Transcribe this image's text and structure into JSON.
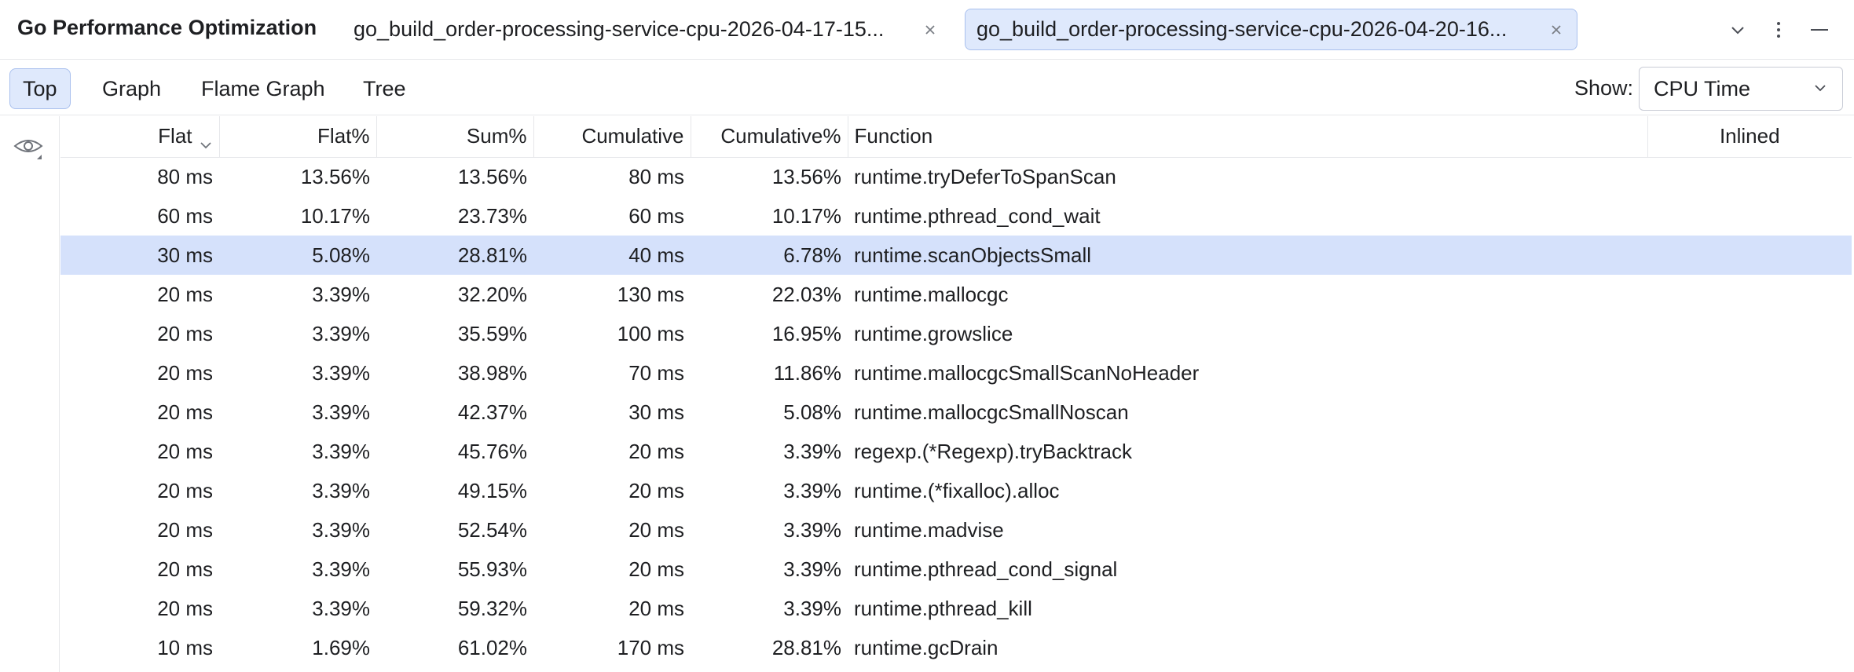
{
  "app": {
    "title": "Go Performance Optimization"
  },
  "tabs": [
    {
      "label": "go_build_order-processing-service-cpu-2026-04-17-15...",
      "active": false
    },
    {
      "label": "go_build_order-processing-service-cpu-2026-04-20-16...",
      "active": true
    }
  ],
  "views": [
    {
      "label": "Top",
      "active": true
    },
    {
      "label": "Graph",
      "active": false
    },
    {
      "label": "Flame Graph",
      "active": false
    },
    {
      "label": "Tree",
      "active": false
    }
  ],
  "show": {
    "label": "Show:",
    "value": "CPU Time"
  },
  "table": {
    "columns": [
      "Flat",
      "Flat%",
      "Sum%",
      "Cumulative",
      "Cumulative%",
      "Function",
      "Inlined"
    ],
    "sorted_by": "Flat",
    "selected_row": 2,
    "rows": [
      [
        "80 ms",
        "13.56%",
        "13.56%",
        "80 ms",
        "13.56%",
        "runtime.tryDeferToSpanScan",
        ""
      ],
      [
        "60 ms",
        "10.17%",
        "23.73%",
        "60 ms",
        "10.17%",
        "runtime.pthread_cond_wait",
        ""
      ],
      [
        "30 ms",
        "5.08%",
        "28.81%",
        "40 ms",
        "6.78%",
        "runtime.scanObjectsSmall",
        ""
      ],
      [
        "20 ms",
        "3.39%",
        "32.20%",
        "130 ms",
        "22.03%",
        "runtime.mallocgc",
        ""
      ],
      [
        "20 ms",
        "3.39%",
        "35.59%",
        "100 ms",
        "16.95%",
        "runtime.growslice",
        ""
      ],
      [
        "20 ms",
        "3.39%",
        "38.98%",
        "70 ms",
        "11.86%",
        "runtime.mallocgcSmallScanNoHeader",
        ""
      ],
      [
        "20 ms",
        "3.39%",
        "42.37%",
        "30 ms",
        "5.08%",
        "runtime.mallocgcSmallNoscan",
        ""
      ],
      [
        "20 ms",
        "3.39%",
        "45.76%",
        "20 ms",
        "3.39%",
        "regexp.(*Regexp).tryBacktrack",
        ""
      ],
      [
        "20 ms",
        "3.39%",
        "49.15%",
        "20 ms",
        "3.39%",
        "runtime.(*fixalloc).alloc",
        ""
      ],
      [
        "20 ms",
        "3.39%",
        "52.54%",
        "20 ms",
        "3.39%",
        "runtime.madvise",
        ""
      ],
      [
        "20 ms",
        "3.39%",
        "55.93%",
        "20 ms",
        "3.39%",
        "runtime.pthread_cond_signal",
        ""
      ],
      [
        "20 ms",
        "3.39%",
        "59.32%",
        "20 ms",
        "3.39%",
        "runtime.pthread_kill",
        ""
      ],
      [
        "10 ms",
        "1.69%",
        "61.02%",
        "170 ms",
        "28.81%",
        "runtime.gcDrain",
        ""
      ]
    ]
  },
  "icons": {
    "tab_close": "close-icon",
    "dropdown": "chevron-down-icon",
    "more": "more-vertical-icon",
    "minimize": "minimize-icon",
    "visibility": "eye-icon"
  },
  "colors": {
    "accent_bg": "#dfe9fc",
    "accent_border": "#a9c0ee",
    "selected_row": "#d5e1fb"
  }
}
